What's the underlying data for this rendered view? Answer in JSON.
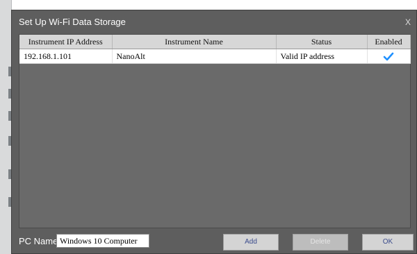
{
  "dialog": {
    "title": "Set Up Wi-Fi Data Storage",
    "close_label": "X"
  },
  "table": {
    "columns": [
      "Instrument IP Address",
      "Instrument Name",
      "Status",
      "Enabled"
    ],
    "rows": [
      {
        "ip": "192.168.1.101",
        "name": "NanoAlt",
        "status": "Valid IP address",
        "enabled": true
      }
    ]
  },
  "footer": {
    "pc_name_label": "PC Name",
    "pc_name_value": "Windows 10 Computer",
    "add_label": "Add",
    "delete_label": "Delete",
    "ok_label": "OK"
  },
  "colors": {
    "dialog_bg": "#5e5e5e",
    "header_bg": "#d7d7d7",
    "check": "#1e90ff"
  },
  "icons": {
    "enabled_check": "check-icon"
  }
}
